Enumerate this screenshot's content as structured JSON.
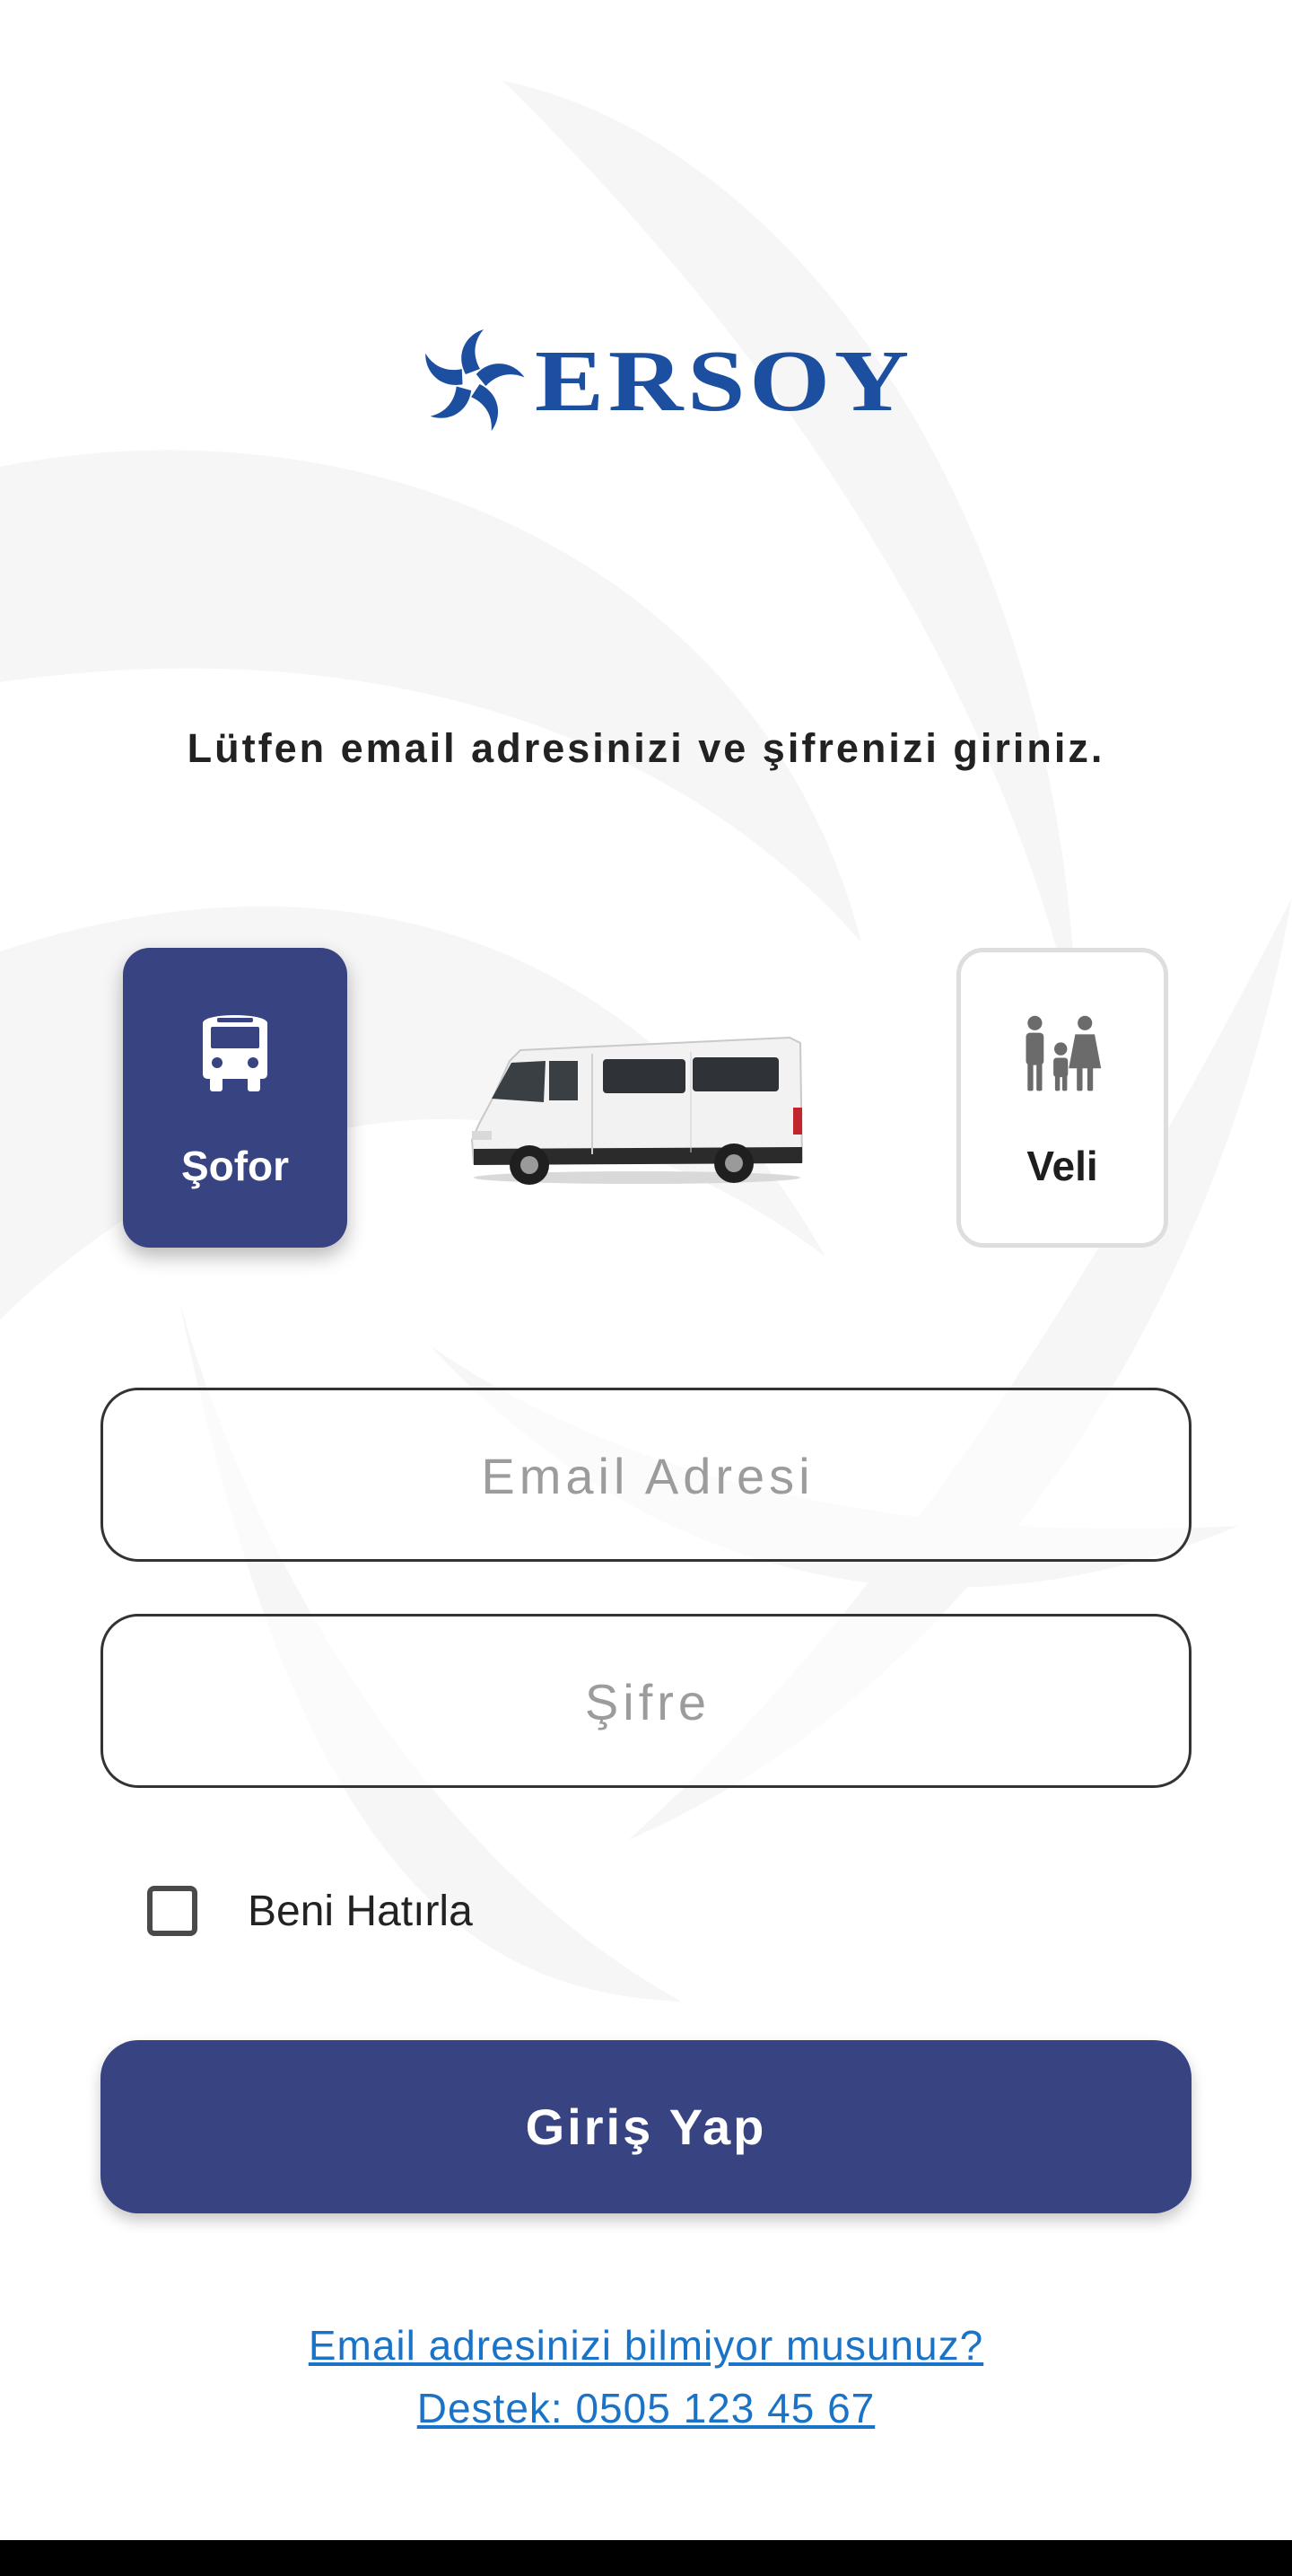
{
  "brand": {
    "name": "ERSOY",
    "color": "#1d4fa0"
  },
  "instruction": "Lütfen email adresinizi ve şifrenizi giriniz.",
  "roles": [
    {
      "label": "Şofor",
      "icon": "bus-icon",
      "selected": true
    },
    {
      "label": "Veli",
      "icon": "family-icon",
      "selected": false
    }
  ],
  "illustration": "minibus-image",
  "form": {
    "email": {
      "placeholder": "Email Adresi",
      "value": ""
    },
    "password": {
      "placeholder": "Şifre",
      "value": ""
    },
    "remember_label": "Beni Hatırla",
    "remember_checked": false,
    "submit_label": "Giriş Yap"
  },
  "help": {
    "line1": "Email adresinizi bilmiyor musunuz?",
    "line2": "Destek: 0505 123 45 67"
  },
  "colors": {
    "primary": "#384382",
    "link": "#1a73c7",
    "border": "#333333",
    "placeholder": "#9c9c9c"
  }
}
